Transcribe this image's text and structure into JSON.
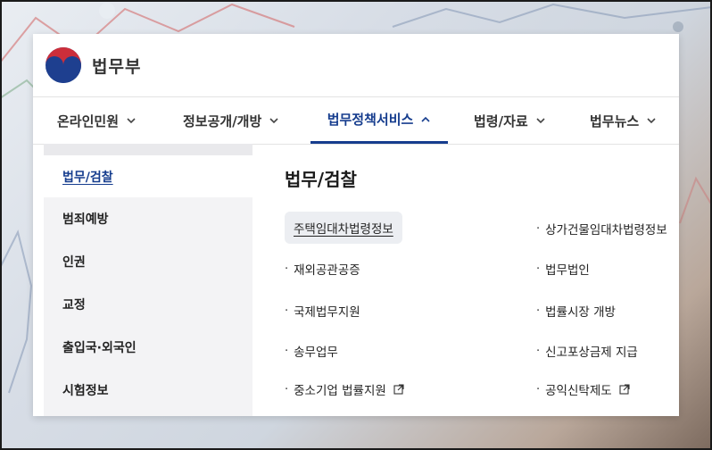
{
  "brand": {
    "name": "법무부",
    "logo_icon": "taegeuk-emblem-icon"
  },
  "nav": {
    "items": [
      {
        "label": "온라인민원",
        "icon": "chevron-down-icon",
        "active": false
      },
      {
        "label": "정보공개/개방",
        "icon": "chevron-down-icon",
        "active": false
      },
      {
        "label": "법무정책서비스",
        "icon": "chevron-up-icon",
        "active": true
      },
      {
        "label": "법령/자료",
        "icon": "chevron-down-icon",
        "active": false
      },
      {
        "label": "법무뉴스",
        "icon": "chevron-down-icon",
        "active": false
      }
    ],
    "active_color": "#163d8e"
  },
  "sidebar": {
    "items": [
      {
        "label": "법무/검찰",
        "active": true
      },
      {
        "label": "범죄예방",
        "active": false
      },
      {
        "label": "인권",
        "active": false
      },
      {
        "label": "교정",
        "active": false
      },
      {
        "label": "출입국·외국인",
        "active": false
      },
      {
        "label": "시험정보",
        "active": false
      }
    ]
  },
  "content": {
    "title": "법무/검찰",
    "left_links": [
      {
        "label": "주택임대차법령정보",
        "highlighted": true,
        "external": false
      },
      {
        "label": "재외공관공증",
        "highlighted": false,
        "external": false
      },
      {
        "label": "국제법무지원",
        "highlighted": false,
        "external": false
      },
      {
        "label": "송무업무",
        "highlighted": false,
        "external": false
      },
      {
        "label": "중소기업 법률지원",
        "highlighted": false,
        "external": true
      }
    ],
    "right_links": [
      {
        "label": "상가건물임대차법령정보",
        "external": false
      },
      {
        "label": "법무법인",
        "external": false
      },
      {
        "label": "법률시장 개방",
        "external": false
      },
      {
        "label": "신고포상금제 지급",
        "external": false
      },
      {
        "label": "공익신탁제도",
        "external": true
      }
    ],
    "bullet": "·",
    "external_icon": "external-link-icon"
  }
}
